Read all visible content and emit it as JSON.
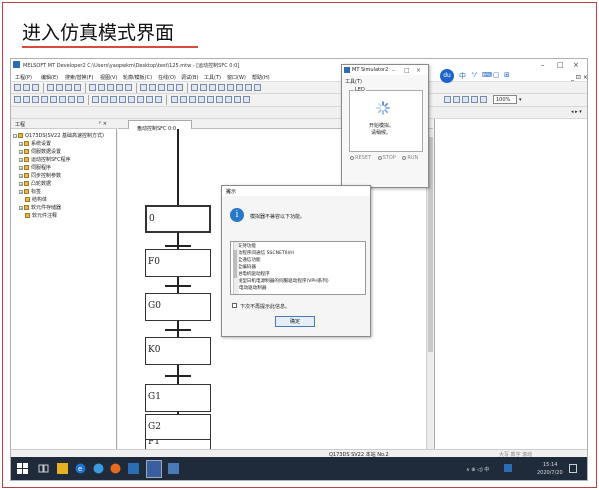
{
  "slide": {
    "title": "进入仿真模式界面",
    "accent": "#d94a3a"
  },
  "window": {
    "title": "MELSOFT MT Developer2 C:\\Users\\yaopwkm\\Desktop\\test\\125.mtw - [运动控制SFC 0:0]",
    "min": "–",
    "max": "□",
    "close": "×"
  },
  "menu": [
    "工程(P)",
    "编辑(E)",
    "搜索/替换(F)",
    "视图(V)",
    "轮廓/模板(C)",
    "在线(O)",
    "调试(B)",
    "工具(T)",
    "窗口(W)",
    "帮助(H)"
  ],
  "toolbar": {
    "zoom": "100%"
  },
  "tree": {
    "header": "工程",
    "pin": "ᵖ ×",
    "items": [
      "Q173DS(SV22 基础高速控制方式)",
      "系统设置",
      "伺服数据设置",
      "运动控制SFC程序",
      "伺服程序",
      "同步控制参数",
      "凸轮数据",
      "标签",
      "结构体",
      "软元件存储器",
      "软元件注释"
    ]
  },
  "editor": {
    "tab_label": "运动控制SFC 0:0",
    "tab_close": "×",
    "steps": [
      "0",
      "F0",
      "G0",
      "K0",
      "G1",
      "F1",
      "G2"
    ]
  },
  "dialog": {
    "title": "提示",
    "close": "×",
    "icon_glyph": "i",
    "message": "模拟器不兼容以下功能。",
    "list": [
      "不支持功能",
      "驱动程序间通信 SSCNETIII/H",
      "安全通信功能",
      "安全编码器",
      "步进电机驱动程序",
      "直线型日机电源制器的伺服驱动程序(VPH系列)",
      "IAI电动驱动制器"
    ],
    "checkbox_label": "下次不再提示此信息。",
    "ok_label": "确定"
  },
  "simulator": {
    "title": "MT Simulator2",
    "menu": "工具(T)",
    "led_label": "LED",
    "status_line1": "开始模拟。",
    "status_line2": "请稍候。",
    "radios": [
      "RESET",
      "STOP",
      "RUN"
    ]
  },
  "statusbar": {
    "cpu": "Q173DS  SV22  本站 No.2",
    "mode": "大写  数字  滚动"
  },
  "taskbar": {
    "time": "15:14",
    "date": "2020/7/20",
    "tray": "∧ ⊕ ◁) 中"
  }
}
